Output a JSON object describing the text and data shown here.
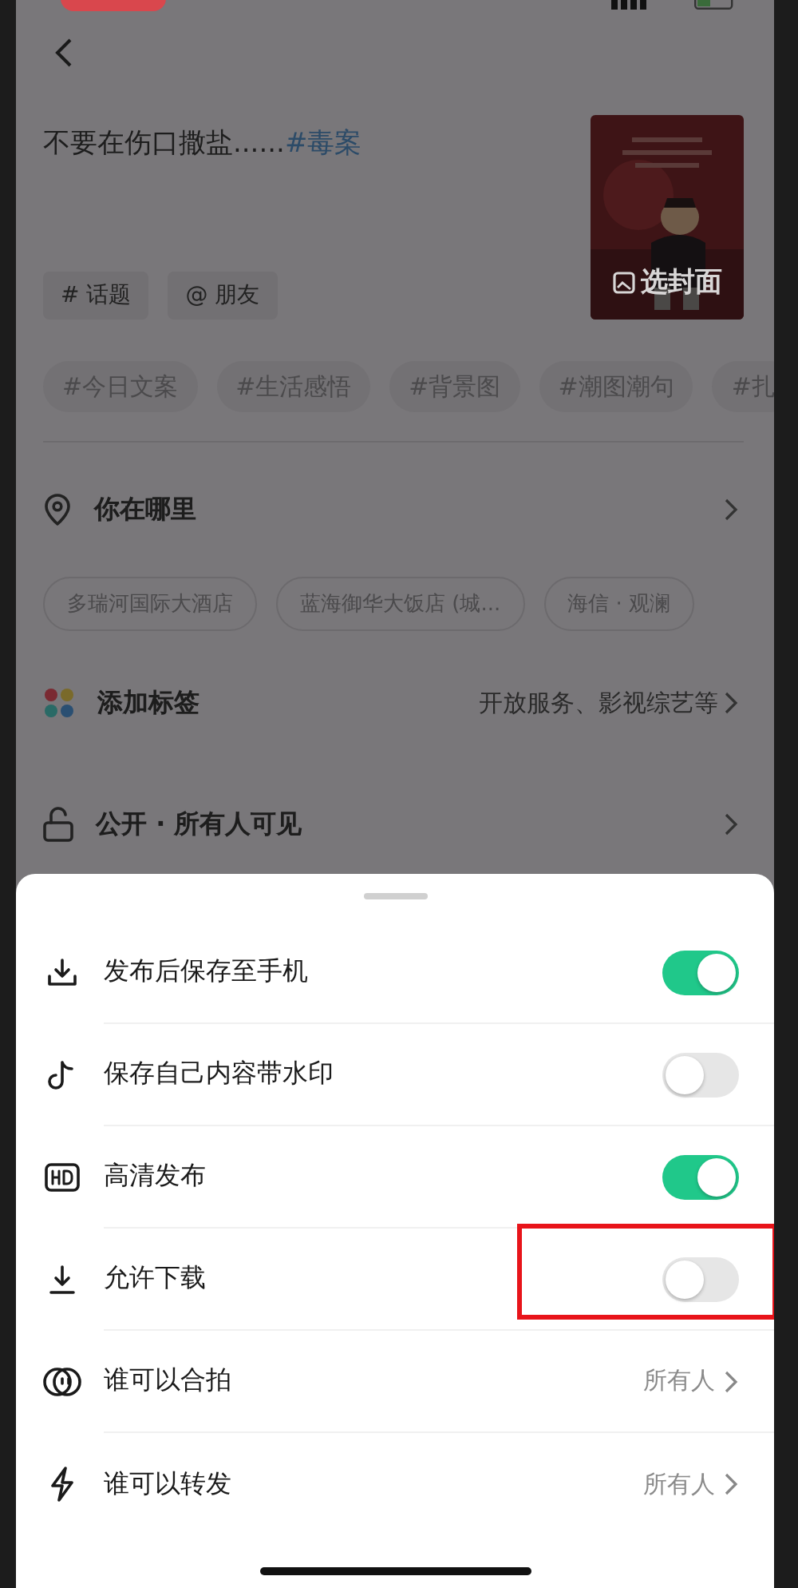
{
  "caption": {
    "text": "不要在伤口撒盐......",
    "hashtag": "#毒案"
  },
  "cover": {
    "label": "选封面"
  },
  "mention_buttons": [
    "# 话题",
    "@ 朋友"
  ],
  "suggested_topics": [
    "#今日文案",
    "#生活感悟",
    "#背景图",
    "#潮图潮句",
    "#扎"
  ],
  "menu": [
    {
      "kind": "location",
      "label": "你在哪里"
    },
    {
      "kind": "chips",
      "chips": [
        "多瑞河国际大酒店",
        "蓝海御华大饭店 (城...",
        "海信 · 观澜"
      ]
    },
    {
      "kind": "tags",
      "label": "添加标签",
      "value": "开放服务、影视综艺等"
    },
    {
      "kind": "privacy",
      "label": "公开 · 所有人可见"
    }
  ],
  "settings": [
    {
      "kind": "toggle",
      "label": "发布后保存至手机",
      "on": true,
      "highlighted": false
    },
    {
      "kind": "toggle",
      "label": "保存自己内容带水印",
      "on": false,
      "highlighted": false
    },
    {
      "kind": "toggle",
      "label": "高清发布",
      "on": true,
      "highlighted": false
    },
    {
      "kind": "toggle",
      "label": "允许下载",
      "on": false,
      "highlighted": true
    },
    {
      "kind": "link",
      "label": "谁可以合拍",
      "value": "所有人"
    },
    {
      "kind": "link",
      "label": "谁可以转发",
      "value": "所有人"
    }
  ]
}
